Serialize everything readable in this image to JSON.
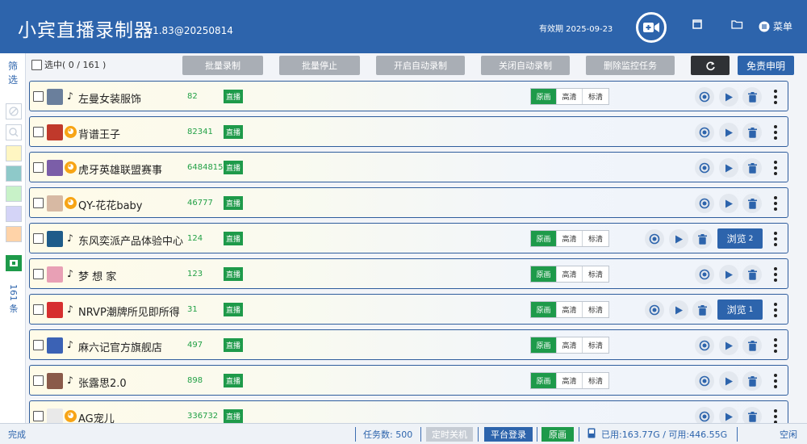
{
  "titlebar": {
    "app_name": "小宾直播录制器",
    "version": "v1.83@20250814",
    "validity": "有效期 2025-09-23",
    "menu_label": "菜单"
  },
  "sidebar": {
    "filter_label": "筛选",
    "color_filters": [
      "#fff6c2",
      "#8ec9c9",
      "#c8f2c8",
      "#d4d4f7",
      "#ffd3a8"
    ],
    "count_label": "161 条"
  },
  "toolbar": {
    "select_all": "选中( 0  /  161 )",
    "batch_record": "批量录制",
    "batch_stop": "批量停止",
    "enable_auto": "开启自动录制",
    "disable_auto": "关闭自动录制",
    "delete_tasks": "删除监控任务",
    "disclaimer": "免责申明"
  },
  "quality_labels": [
    "原画",
    "高清",
    "标清"
  ],
  "live_label": "直播",
  "browse_label": "浏览",
  "rows": [
    {
      "name": "左曼女装服饰",
      "count": "82",
      "platform": "tiktok",
      "avatar": "#6a7f9c",
      "quality": true,
      "browse": null
    },
    {
      "name": "背谱王子",
      "count": "82341",
      "platform": "huya",
      "avatar": "#c0392b",
      "quality": false,
      "browse": null
    },
    {
      "name": "虎牙英雄联盟赛事",
      "count": "6484815",
      "platform": "huya",
      "avatar": "#7b5ea8",
      "quality": false,
      "browse": null
    },
    {
      "name": "QY-花花baby",
      "count": "46777",
      "platform": "huya",
      "avatar": "#d7b9a3",
      "quality": false,
      "browse": null
    },
    {
      "name": "东风奕派产品体验中心",
      "count": "124",
      "platform": "tiktok",
      "avatar": "#1f5c8a",
      "quality": true,
      "browse": "2"
    },
    {
      "name": "梦 想 家",
      "count": "123",
      "platform": "tiktok",
      "avatar": "#e8a0b5",
      "quality": true,
      "browse": null
    },
    {
      "name": "NRVP潮牌所见即所得",
      "count": "31",
      "platform": "tiktok",
      "avatar": "#d62f2f",
      "quality": true,
      "browse": "1"
    },
    {
      "name": "麻六记官方旗舰店",
      "count": "497",
      "platform": "tiktok",
      "avatar": "#3b62b5",
      "quality": true,
      "browse": null
    },
    {
      "name": "张露思2.0",
      "count": "898",
      "platform": "tiktok",
      "avatar": "#8a5a4a",
      "quality": true,
      "browse": null
    },
    {
      "name": "AG宠儿",
      "count": "336732",
      "platform": "huya",
      "avatar": "#e9e9e9",
      "quality": false,
      "browse": null
    }
  ],
  "statusbar": {
    "status": "完成",
    "tasks": "任务数: 500",
    "scheduled_shutdown": "定时关机",
    "platform_login": "平台登录",
    "original": "原画",
    "disk": "已用:163.77G / 可用:446.55G",
    "idle": "空闲"
  },
  "colors": {
    "brand": "#2d64ac",
    "live_green": "#1e9a4a"
  }
}
